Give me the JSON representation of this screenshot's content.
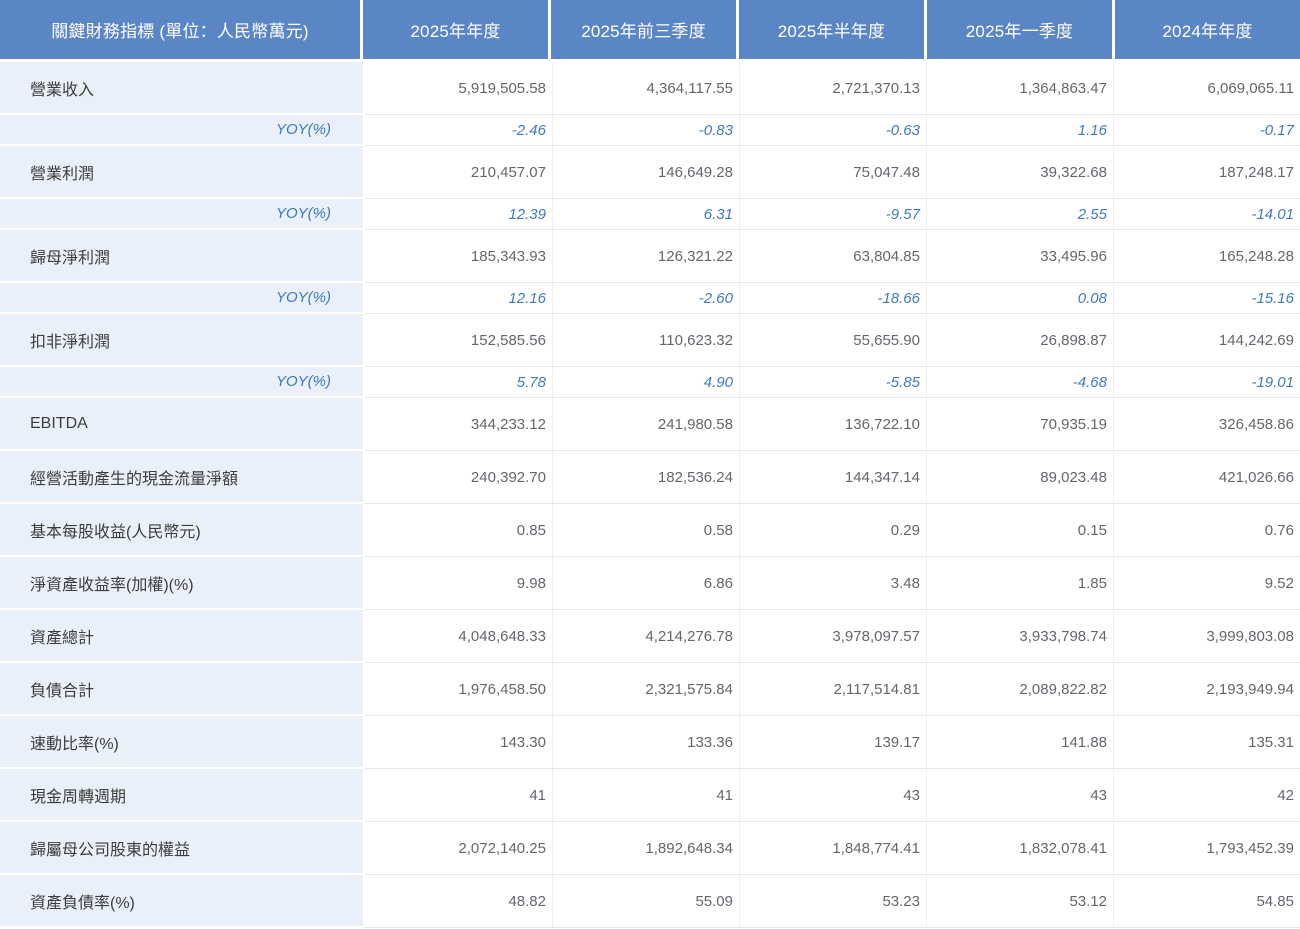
{
  "colors": {
    "header_bg": "#5b86c6",
    "header_text": "#ffffff",
    "label_column_bg": "#e9f0f9",
    "label_text": "#3d3d3d",
    "value_text": "#63666c",
    "yoy_text": "#3e78c4",
    "row_border": "#e6e6e6"
  },
  "table": {
    "header": {
      "label": "關鍵財務指標 (單位：人民幣萬元)",
      "columns": [
        "2025年年度",
        "2025年前三季度",
        "2025年半年度",
        "2025年一季度",
        "2024年年度"
      ]
    },
    "rows": [
      {
        "type": "metric",
        "label": "營業收入",
        "values": [
          "5,919,505.58",
          "4,364,117.55",
          "2,721,370.13",
          "1,364,863.47",
          "6,069,065.11"
        ]
      },
      {
        "type": "yoy",
        "label": "YOY(%)",
        "values": [
          "-2.46",
          "-0.83",
          "-0.63",
          "1.16",
          "-0.17"
        ]
      },
      {
        "type": "metric",
        "label": "營業利潤",
        "values": [
          "210,457.07",
          "146,649.28",
          "75,047.48",
          "39,322.68",
          "187,248.17"
        ]
      },
      {
        "type": "yoy",
        "label": "YOY(%)",
        "values": [
          "12.39",
          "6.31",
          "-9.57",
          "2.55",
          "-14.01"
        ]
      },
      {
        "type": "metric",
        "label": "歸母淨利潤",
        "values": [
          "185,343.93",
          "126,321.22",
          "63,804.85",
          "33,495.96",
          "165,248.28"
        ]
      },
      {
        "type": "yoy",
        "label": "YOY(%)",
        "values": [
          "12.16",
          "-2.60",
          "-18.66",
          "0.08",
          "-15.16"
        ]
      },
      {
        "type": "metric",
        "label": "扣非淨利潤",
        "values": [
          "152,585.56",
          "110,623.32",
          "55,655.90",
          "26,898.87",
          "144,242.69"
        ]
      },
      {
        "type": "yoy",
        "label": "YOY(%)",
        "values": [
          "5.78",
          "4.90",
          "-5.85",
          "-4.68",
          "-19.01"
        ]
      },
      {
        "type": "metric",
        "label": "EBITDA",
        "values": [
          "344,233.12",
          "241,980.58",
          "136,722.10",
          "70,935.19",
          "326,458.86"
        ]
      },
      {
        "type": "metric",
        "label": "經營活動產生的現金流量淨額",
        "values": [
          "240,392.70",
          "182,536.24",
          "144,347.14",
          "89,023.48",
          "421,026.66"
        ]
      },
      {
        "type": "metric",
        "label": "基本每股收益(人民幣元)",
        "values": [
          "0.85",
          "0.58",
          "0.29",
          "0.15",
          "0.76"
        ]
      },
      {
        "type": "metric",
        "label": "淨資產收益率(加權)(%)",
        "values": [
          "9.98",
          "6.86",
          "3.48",
          "1.85",
          "9.52"
        ]
      },
      {
        "type": "metric",
        "label": "資產總計",
        "values": [
          "4,048,648.33",
          "4,214,276.78",
          "3,978,097.57",
          "3,933,798.74",
          "3,999,803.08"
        ]
      },
      {
        "type": "metric",
        "label": "負債合計",
        "values": [
          "1,976,458.50",
          "2,321,575.84",
          "2,117,514.81",
          "2,089,822.82",
          "2,193,949.94"
        ]
      },
      {
        "type": "metric",
        "label": "速動比率(%)",
        "values": [
          "143.30",
          "133.36",
          "139.17",
          "141.88",
          "135.31"
        ]
      },
      {
        "type": "metric",
        "label": "現金周轉週期",
        "values": [
          "41",
          "41",
          "43",
          "43",
          "42"
        ]
      },
      {
        "type": "metric",
        "label": "歸屬母公司股東的權益",
        "values": [
          "2,072,140.25",
          "1,892,648.34",
          "1,848,774.41",
          "1,832,078.41",
          "1,793,452.39"
        ]
      },
      {
        "type": "metric",
        "label": "資產負債率(%)",
        "values": [
          "48.82",
          "55.09",
          "53.23",
          "53.12",
          "54.85"
        ]
      }
    ]
  }
}
